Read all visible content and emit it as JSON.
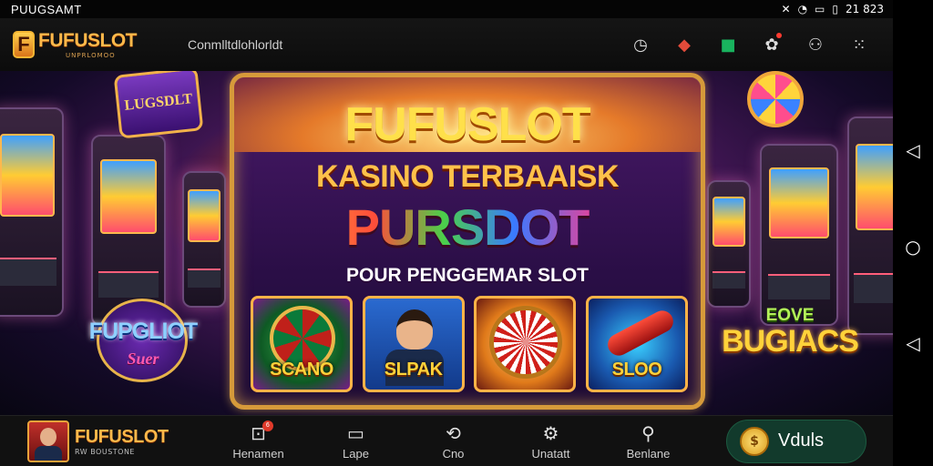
{
  "statusbar": {
    "title": "PUUGSAMT",
    "time": "21 823"
  },
  "header": {
    "logo_letter": "F",
    "logo_name": "FUFUSLOT",
    "logo_sub": "UNPRLOMOO",
    "link": "Conmlltdlohlorldt",
    "icons": [
      "timer-icon",
      "gift-icon",
      "chat-icon",
      "notification-icon",
      "support-icon",
      "menu-dots-icon"
    ]
  },
  "hero": {
    "title": "FUFUSLOT",
    "subtitle": "KASINO TERBAAISK",
    "headline": "PURSDOT",
    "tagline": "POUR PENGGEMAR SLOT",
    "left_sign": "LUGSDLT",
    "left_promo_title": "FUPGLIOT",
    "left_promo_sub": "Suer",
    "right_promo_title": "EOVE",
    "right_promo_sub": "BUGIACS",
    "cards": [
      {
        "label": "SCANO"
      },
      {
        "label": "SLPAK"
      },
      {
        "label": ""
      },
      {
        "label": "SLOO"
      }
    ]
  },
  "bottom_nav": {
    "brand_name": "FUFUSLOT",
    "brand_sub": "RW BOUSTONE",
    "items": [
      {
        "label": "Henamen",
        "icon": "alert-box-icon",
        "badge": "6"
      },
      {
        "label": "Lape",
        "icon": "monitor-icon"
      },
      {
        "label": "Cno",
        "icon": "refresh-icon"
      },
      {
        "label": "Unatatt",
        "icon": "settings-icon"
      },
      {
        "label": "Benlane",
        "icon": "user-icon"
      }
    ],
    "cta_label": "Vduls"
  },
  "colors": {
    "accent_gold": "#ffb94a",
    "cta_bg": "#123a2c",
    "badge_red": "#e03a2a"
  }
}
